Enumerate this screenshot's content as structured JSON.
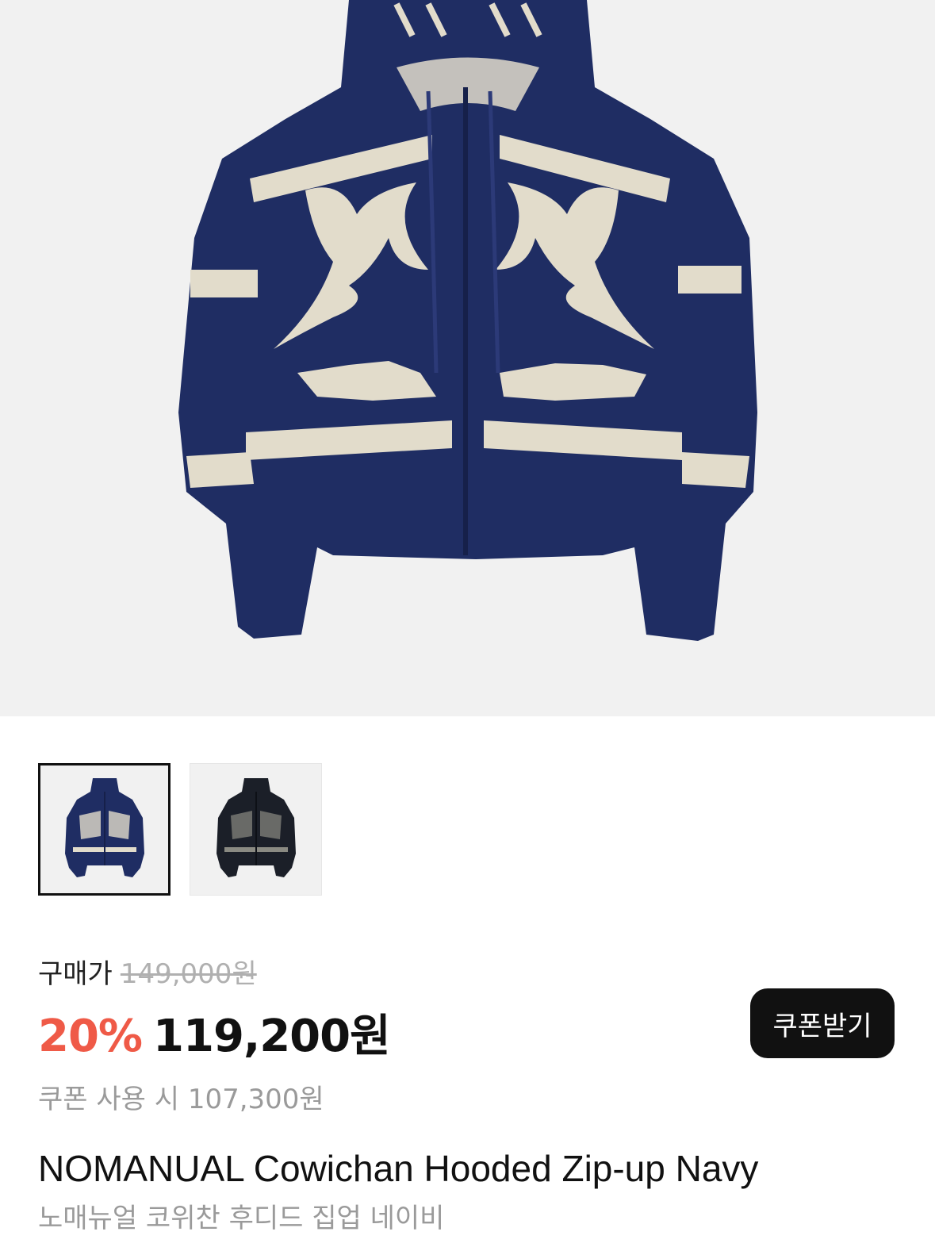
{
  "product": {
    "images": [
      {
        "name": "hoodie-navy",
        "color": "#1f2d63",
        "selected": true
      },
      {
        "name": "hoodie-black",
        "color": "#1b1f28",
        "selected": false
      }
    ],
    "price_label": "구매가",
    "original_price": "149,000원",
    "discount_rate": "20%",
    "final_price": "119,200원",
    "coupon_price_text": "쿠폰 사용 시 107,300원",
    "coupon_button_label": "쿠폰받기",
    "title_en": "NOMANUAL Cowichan Hooded Zip-up Navy",
    "title_ko": "노매뉴얼 코위찬 후디드 집업 네이비"
  },
  "colors": {
    "discount": "#ef5a47",
    "coupon_button_bg": "#111111",
    "hero_bg": "#f1f1f1",
    "knit_navy": "#1f2d63",
    "knit_cream": "#e2dccb"
  }
}
